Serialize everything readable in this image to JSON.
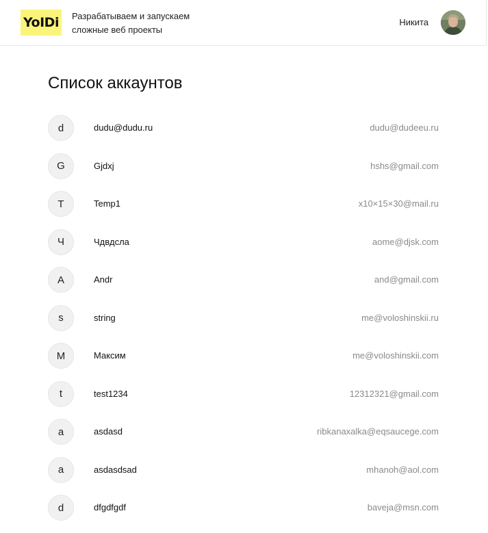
{
  "header": {
    "logo_text": "YoIDi",
    "tagline_line1": "Разрабатываем и запускаем",
    "tagline_line2": "сложные веб проекты",
    "user_name": "Никита",
    "avatar_icon": "user-photo"
  },
  "main": {
    "title": "Список аккаунтов",
    "accounts": [
      {
        "initial": "d",
        "name": "dudu@dudu.ru",
        "email": "dudu@dudeeu.ru"
      },
      {
        "initial": "G",
        "name": "Gjdxj",
        "email": "hshs@gmail.com"
      },
      {
        "initial": "T",
        "name": "Temp1",
        "email": "x10×15×30@mail.ru"
      },
      {
        "initial": "Ч",
        "name": "Чдвдсла",
        "email": "aome@djsk.com"
      },
      {
        "initial": "A",
        "name": "Andr",
        "email": "and@gmail.com"
      },
      {
        "initial": "s",
        "name": "string",
        "email": "me@voloshinskii.ru"
      },
      {
        "initial": "M",
        "name": "Максим",
        "email": "me@voloshinskii.com"
      },
      {
        "initial": "t",
        "name": "test1234",
        "email": "12312321@gmail.com"
      },
      {
        "initial": "a",
        "name": "asdasd",
        "email": "ribkanaxalka@eqsaucege.com"
      },
      {
        "initial": "a",
        "name": "asdasdsad",
        "email": "mhanoh@aol.com"
      },
      {
        "initial": "d",
        "name": "dfgdfgdf",
        "email": "baveja@msn.com"
      }
    ]
  },
  "colors": {
    "logo_background": "#faf57a",
    "initial_circle_background": "#f1f1f1",
    "email_text": "#8a8a8a",
    "divider": "#e8e8e8"
  }
}
